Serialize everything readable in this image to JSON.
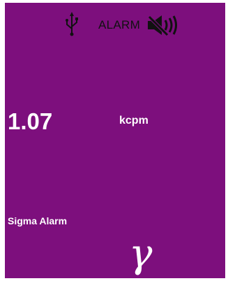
{
  "status_bar": {
    "usb_icon": "usb-icon",
    "alarm_label": "ALARM",
    "mute_icon": "speaker-muted-icon"
  },
  "reading": {
    "value": "1.07",
    "unit": "kcpm"
  },
  "alarm_mode": "Sigma Alarm",
  "radiation_type": "γ",
  "colors": {
    "background": "#7d0f7d",
    "text": "#ffffff",
    "status_text": "#111111"
  }
}
